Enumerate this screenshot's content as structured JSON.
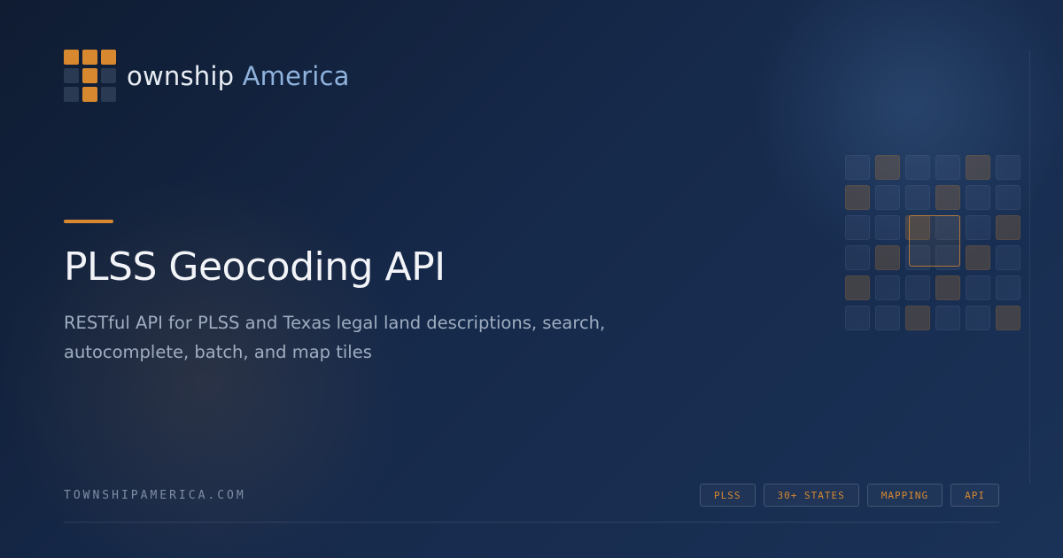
{
  "brand": {
    "prefix": "ownship",
    "accent": "America"
  },
  "logo_grid": [
    1,
    1,
    1,
    0,
    1,
    0,
    0,
    1,
    0
  ],
  "hero": {
    "title": "PLSS Geocoding API",
    "subtitle": "RESTful API for PLSS and Texas legal land descriptions, search, autocomplete, batch, and map tiles"
  },
  "footer": {
    "domain": "TOWNSHIPAMERICA.COM",
    "tags": [
      "PLSS",
      "30+ STATES",
      "MAPPING",
      "API"
    ]
  },
  "decor_grid": [
    0,
    1,
    0,
    0,
    1,
    0,
    1,
    0,
    0,
    1,
    0,
    0,
    0,
    0,
    1,
    0,
    0,
    1,
    0,
    1,
    0,
    0,
    1,
    0,
    1,
    0,
    0,
    1,
    0,
    0,
    0,
    0,
    1,
    0,
    0,
    1
  ],
  "colors": {
    "accent": "#d8892f",
    "brand_accent": "#8fb2dc",
    "background": "#16294a"
  }
}
